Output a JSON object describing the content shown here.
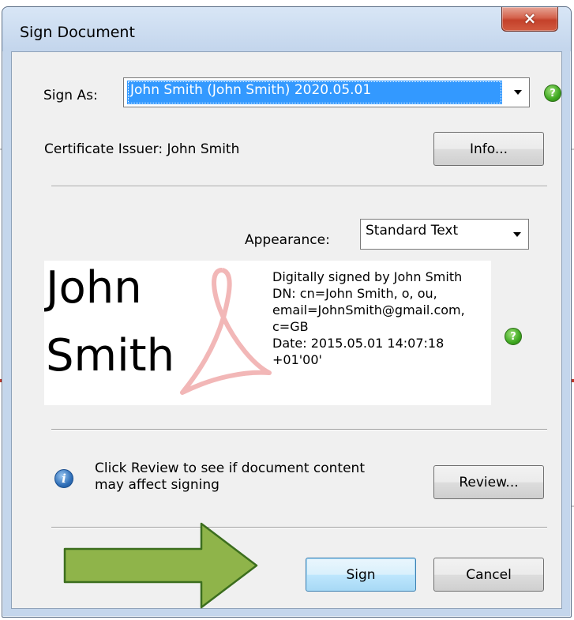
{
  "window": {
    "title": "Sign Document",
    "close_glyph": "×"
  },
  "sign_as": {
    "label": "Sign As:",
    "selected": "John Smith (John Smith) 2020.05.01"
  },
  "certificate": {
    "issuer_text": "Certificate Issuer: John Smith",
    "info_button": "Info..."
  },
  "appearance": {
    "label": "Appearance:",
    "selected": "Standard Text"
  },
  "signature_preview": {
    "name_line1": "John",
    "name_line2": "Smith",
    "details": [
      "Digitally signed by John Smith",
      "DN: cn=John Smith, o, ou,",
      "email=JohnSmith@gmail.com,",
      "c=GB",
      "Date: 2015.05.01 14:07:18",
      "+01'00'"
    ]
  },
  "review": {
    "message_line1": "Click Review to see if document content",
    "message_line2": "may affect signing",
    "button": "Review..."
  },
  "actions": {
    "sign_button": "Sign",
    "cancel_button": "Cancel"
  },
  "icons": {
    "help": "?",
    "info": "i"
  },
  "colors": {
    "selection": "#3399ff",
    "help_green": "#3ea820",
    "arrow_green": "#8fb44a",
    "arrow_border": "#3c6e1e",
    "close_red": "#c4412a"
  }
}
